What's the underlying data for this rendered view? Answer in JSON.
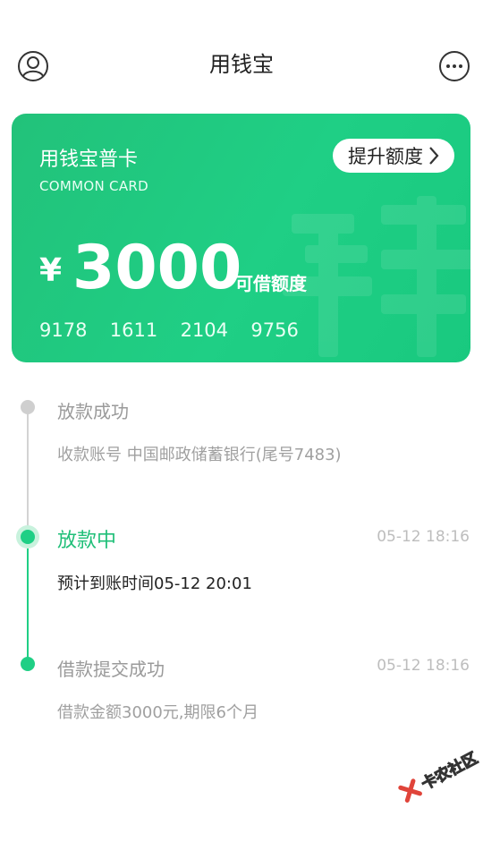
{
  "header": {
    "title": "用钱宝",
    "profile_icon": "user-circle-icon",
    "more_icon": "more-dots-icon"
  },
  "card": {
    "name": "用钱宝普卡",
    "subtitle": "COMMON CARD",
    "raise_button": "提升额度",
    "currency": "¥",
    "amount": "3000",
    "amount_label": "可借额度",
    "card_number": "9178  1611  2104  9756",
    "accent_color": "#1fcf85"
  },
  "timeline": [
    {
      "title": "放款成功",
      "detail": "收款账号 中国邮政储蓄银行(尾号7483)",
      "time": "",
      "state": "pending"
    },
    {
      "title": "放款中",
      "detail": "预计到账时间05-12 20:01",
      "time": "05-12 18:16",
      "state": "current"
    },
    {
      "title": "借款提交成功",
      "detail": "借款金额3000元,期限6个月",
      "time": "05-12 18:16",
      "state": "done"
    }
  ],
  "watermark": {
    "text": "卡农社区"
  }
}
